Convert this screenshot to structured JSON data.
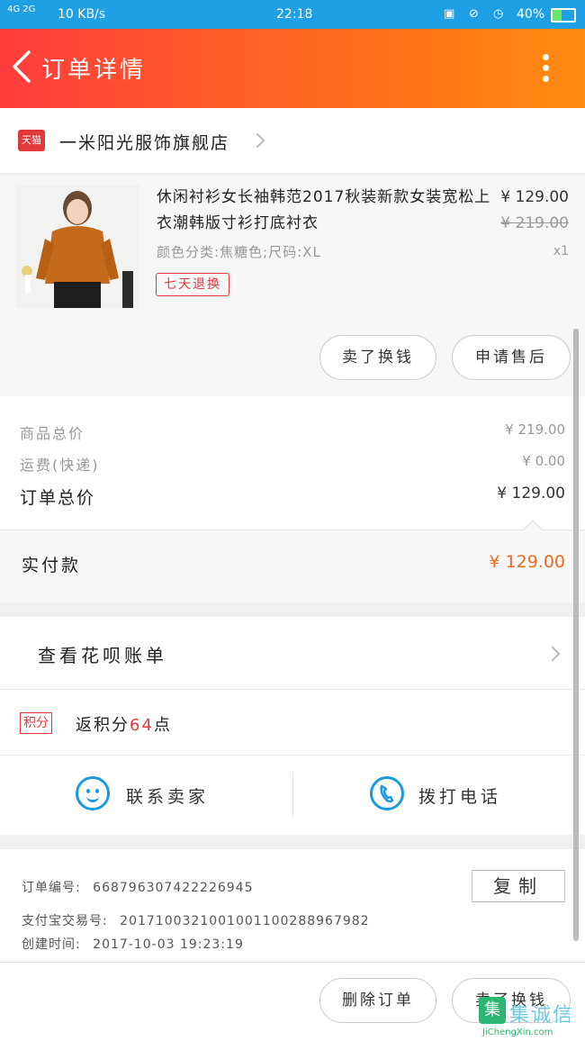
{
  "status_bar": {
    "network": "4G 2G",
    "speed": "10 KB/s",
    "time": "22:18",
    "battery": "40%"
  },
  "header": {
    "title": "订单详情"
  },
  "store": {
    "badge": "天猫",
    "name": "一米阳光服饰旗舰店"
  },
  "product": {
    "title": "休闲衬衫女长袖韩范2017秋装新款女装宽松上衣潮韩版寸衫打底衬衣",
    "price": "¥ 129.00",
    "original_price": "¥ 219.00",
    "spec": "颜色分类:焦糖色;尺码:XL",
    "quantity": "x1",
    "tag": "七天退换",
    "buttons": [
      "卖了换钱",
      "申请售后"
    ]
  },
  "summary": {
    "goods_total_label": "商品总价",
    "goods_total_value": "¥ 219.00",
    "shipping_label": "运费(快递)",
    "shipping_value": "¥ 0.00",
    "order_total_label": "订单总价",
    "order_total_value": "¥ 129.00",
    "paid_label": "实付款",
    "paid_value": "¥ 129.00"
  },
  "huabei": {
    "label": "查看花呗账单"
  },
  "points": {
    "badge": "积分",
    "prefix": "返积分",
    "count": "64",
    "suffix": "点"
  },
  "contact": {
    "seller_label": "联系卖家",
    "call_label": "拨打电话"
  },
  "order_info": {
    "order_no_label": "订单编号:",
    "order_no": "668796307422226945",
    "alipay_label": "支付宝交易号:",
    "alipay_no": "2017100321001001100288967982",
    "created_label": "创建时间:",
    "created": "2017-10-03 19:23:19",
    "copy_label": "复制"
  },
  "bottom_bar": {
    "delete_label": "删除订单",
    "resell_label": "卖了换钱"
  },
  "watermark": {
    "text": "JiChengXin.com",
    "brand": "集诚信"
  },
  "colors": {
    "accent_red": "#e4393c",
    "price_orange": "#f06a1c",
    "status_blue": "#1fa0e6",
    "icon_blue": "#1b9ae0"
  }
}
